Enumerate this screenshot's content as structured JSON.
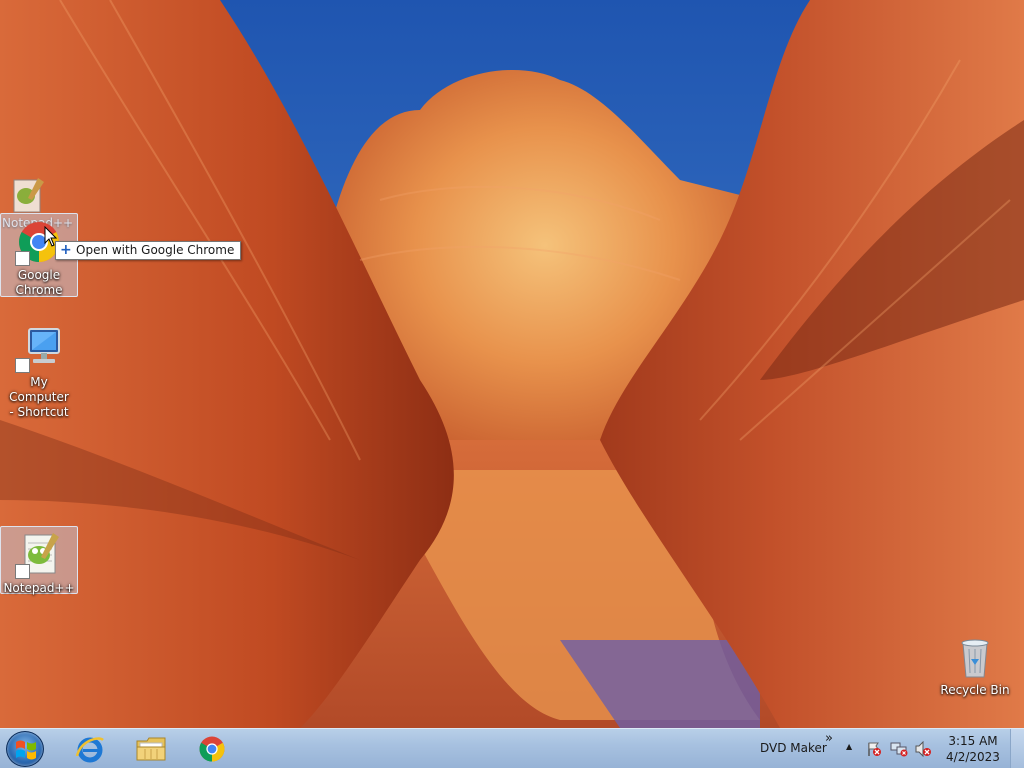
{
  "desktop": {
    "icons": [
      {
        "label": "Google Chrome",
        "line1": "Google",
        "line2": "Chrome",
        "icon": "chrome-icon"
      },
      {
        "label": "My Computer - Shortcut",
        "line1": "My Computer",
        "line2": "- Shortcut",
        "icon": "computer-icon"
      },
      {
        "label": "Notepad++",
        "line1": "Notepad++",
        "icon": "notepadpp-icon"
      },
      {
        "label": "Recycle Bin",
        "line1": "Recycle Bin",
        "icon": "recycle-bin-icon"
      }
    ],
    "drag_ghost_label": "Notepad++",
    "drop_tooltip": "Open with Google Chrome",
    "drop_tooltip_symbol": "+"
  },
  "taskbar": {
    "pinned": [
      {
        "name": "Internet Explorer",
        "icon": "internet-explorer-icon"
      },
      {
        "name": "Windows Explorer",
        "icon": "folder-icon"
      },
      {
        "name": "Google Chrome",
        "icon": "chrome-icon"
      }
    ],
    "toolbar_label": "DVD Maker",
    "toolbar_chevron": "»",
    "tray_expand": "▲",
    "clock_time": "3:15 AM",
    "clock_date": "4/2/2023"
  },
  "colors": {
    "taskbar": "#a7c1e0",
    "selection": "#bed7f5",
    "sky": "#2b62b8",
    "rock": "#c8542b"
  }
}
